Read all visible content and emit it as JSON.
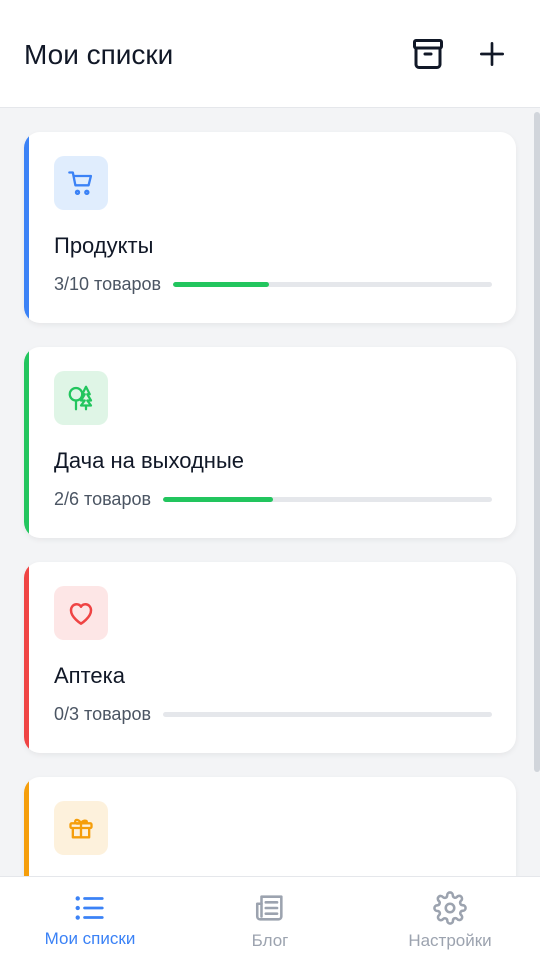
{
  "header": {
    "title": "Мои списки",
    "archive_icon": "archive-icon",
    "add_icon": "plus-icon"
  },
  "lists": [
    {
      "title": "Продукты",
      "count_text": "3/10 товаров",
      "progress": 0.3,
      "icon": "shopping-cart-icon",
      "accent": "#3b82f6",
      "icon_bg": "#e0edfd"
    },
    {
      "title": "Дача на выходные",
      "count_text": "2/6 товаров",
      "progress": 0.333,
      "icon": "trees-icon",
      "accent": "#22c55e",
      "icon_bg": "#dff5e6"
    },
    {
      "title": "Аптека",
      "count_text": "0/3 товаров",
      "progress": 0,
      "icon": "heart-icon",
      "accent": "#ef4444",
      "icon_bg": "#fde6e6"
    },
    {
      "title": "",
      "count_text": "",
      "progress": 0,
      "icon": "gift-icon",
      "accent": "#f59e0b",
      "icon_bg": "#fdf1dc"
    }
  ],
  "progress_color": "#22c55e",
  "bottom_nav": {
    "items": [
      {
        "label": "Мои списки",
        "icon": "list-icon",
        "active": true
      },
      {
        "label": "Блог",
        "icon": "newspaper-icon",
        "active": false
      },
      {
        "label": "Настройки",
        "icon": "gear-icon",
        "active": false
      }
    ],
    "active_color": "#3b82f6",
    "inactive_color": "#9ca3af"
  }
}
